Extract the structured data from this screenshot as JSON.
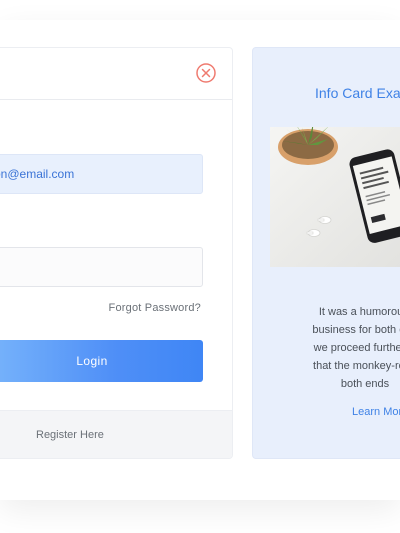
{
  "login": {
    "email_value": "on@email.com",
    "password_value": "",
    "forgot_label": "Forgot Password?",
    "login_label": "Login",
    "register_label": "Register Here"
  },
  "info_card": {
    "title": "Info Card Exa",
    "text_lines": [
      "It was a humorousl",
      "business for both of u",
      "we proceed further, it",
      "that the monkey-rope",
      "both ends"
    ],
    "learn_more_label": "Learn Mor"
  },
  "icons": {
    "close": "close-circle-icon"
  },
  "colors": {
    "accent": "#3f82e6",
    "close_icon": "#ef7b70",
    "info_card_bg": "#e8effc",
    "email_field_bg": "#e8f0fd"
  }
}
